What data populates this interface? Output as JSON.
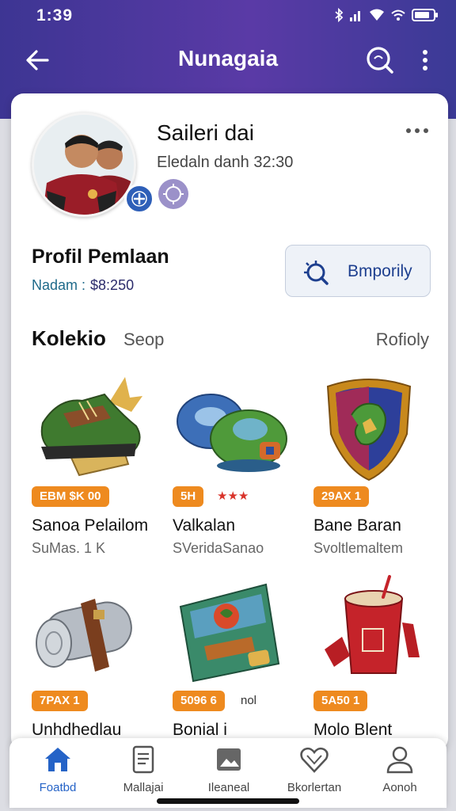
{
  "status_bar": {
    "time": "1:39"
  },
  "app_bar": {
    "title": "Nunagaia"
  },
  "profile": {
    "name": "Saileri dai",
    "subtitle": "Eledaln danh 32:30"
  },
  "profile_section": {
    "title": "Profil Pemlaan",
    "balance_label": "Nadam :",
    "balance_value": "$8:250",
    "action_label": "Bmporily"
  },
  "collection": {
    "title": "Kolekio",
    "tab": "Seop",
    "link": "Rofioly"
  },
  "items": [
    {
      "tag": "EBM $K 00",
      "tag_extra": "",
      "name": "Sanoa Pelailom",
      "sub": "SuMas. 1 K"
    },
    {
      "tag": "5H",
      "tag_extra": "★★★",
      "name": "Valkalan",
      "sub": "SVeridaSanao"
    },
    {
      "tag": "29AX 1",
      "tag_extra": "",
      "name": "Bane Baran",
      "sub": "Svoltlemaltem"
    },
    {
      "tag": "7PAX 1",
      "tag_extra": "",
      "name": "Unhdhedlau",
      "sub": ""
    },
    {
      "tag": "5096 6",
      "tag_extra": "nol",
      "name": "Bonial i",
      "sub": ""
    },
    {
      "tag": "5A50 1",
      "tag_extra": "",
      "name": "Molo Blent",
      "sub": ""
    }
  ],
  "bottom_nav": [
    {
      "label": "Foatbd",
      "icon": "home-icon"
    },
    {
      "label": "Mallajai",
      "icon": "document-icon"
    },
    {
      "label": "Ileaneal",
      "icon": "image-icon"
    },
    {
      "label": "Bkorlertan",
      "icon": "heart-icon"
    },
    {
      "label": "Aonoh",
      "icon": "profile-icon"
    }
  ],
  "colors": {
    "app_bar": "#4a379e",
    "accent": "#2563c7",
    "tag": "#ee8a1f"
  }
}
